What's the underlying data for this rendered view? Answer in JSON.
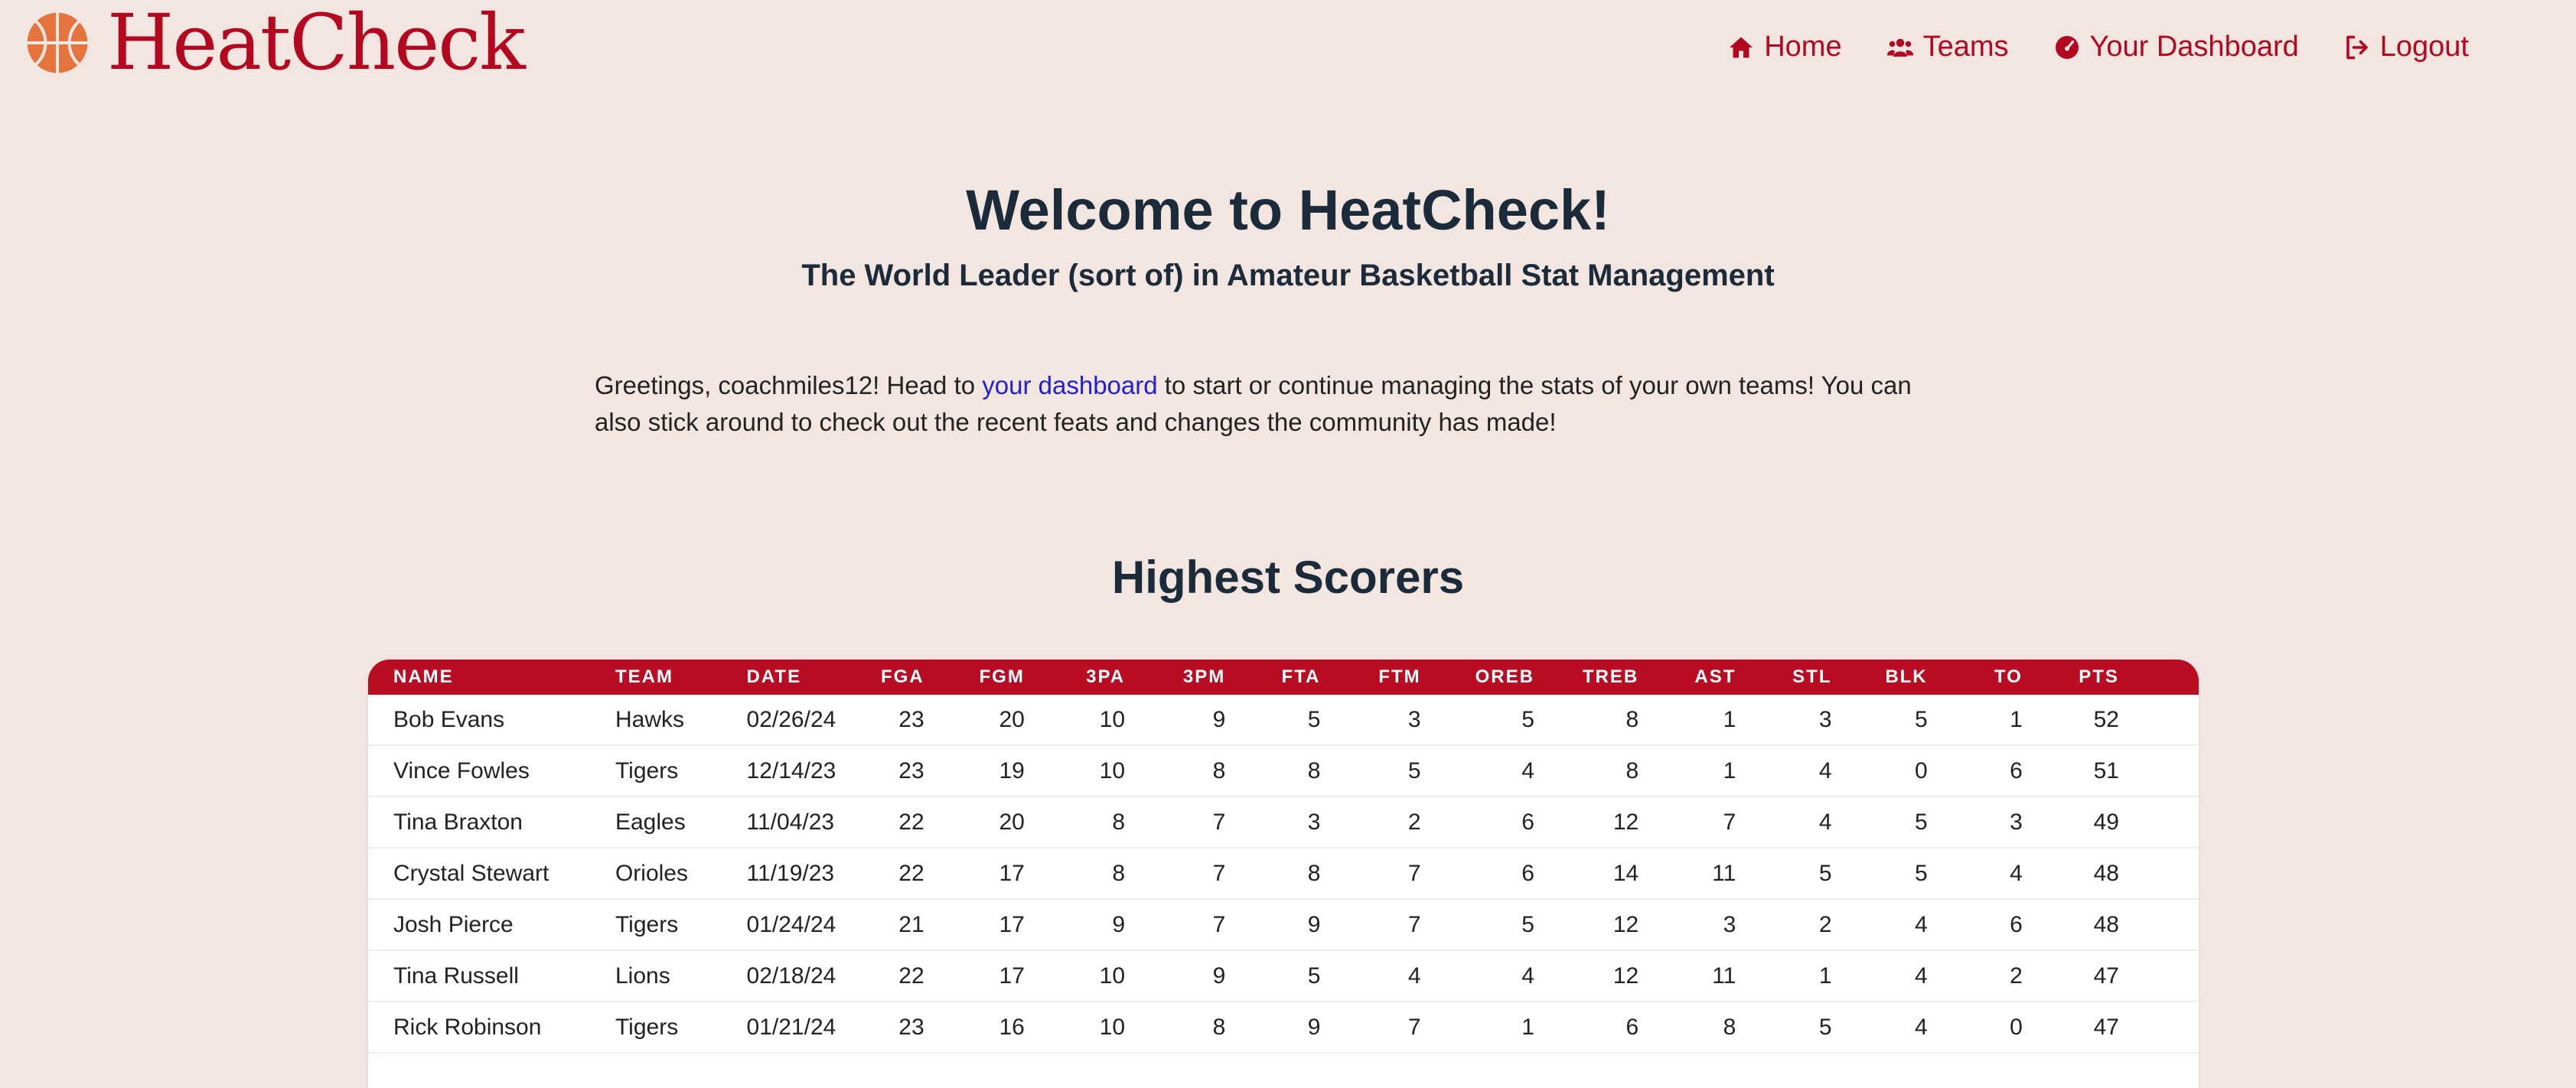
{
  "brand": {
    "name": "HeatCheck"
  },
  "nav": [
    {
      "label": "Home",
      "icon": "home-icon"
    },
    {
      "label": "Teams",
      "icon": "users-icon"
    },
    {
      "label": "Your Dashboard",
      "icon": "gauge-icon"
    },
    {
      "label": "Logout",
      "icon": "logout-icon"
    }
  ],
  "hero": {
    "title": "Welcome to HeatCheck!",
    "subtitle": "The World Leader (sort of) in Amateur Basketball Stat Management"
  },
  "intro": {
    "before_link": "Greetings, coachmiles12! Head to ",
    "link": "your dashboard",
    "after_link": " to start or continue managing the stats of your own teams! You can also stick around to check out the recent feats and changes the community has made!"
  },
  "section": {
    "title": "Highest Scorers"
  },
  "table": {
    "columns": [
      "NAME",
      "TEAM",
      "DATE",
      "FGA",
      "FGM",
      "3PA",
      "3PM",
      "FTA",
      "FTM",
      "OREB",
      "TREB",
      "AST",
      "STL",
      "BLK",
      "TO",
      "PTS"
    ],
    "rows": [
      [
        "Bob Evans",
        "Hawks",
        "02/26/24",
        "23",
        "20",
        "10",
        "9",
        "5",
        "3",
        "5",
        "8",
        "1",
        "3",
        "5",
        "1",
        "52"
      ],
      [
        "Vince Fowles",
        "Tigers",
        "12/14/23",
        "23",
        "19",
        "10",
        "8",
        "8",
        "5",
        "4",
        "8",
        "1",
        "4",
        "0",
        "6",
        "51"
      ],
      [
        "Tina Braxton",
        "Eagles",
        "11/04/23",
        "22",
        "20",
        "8",
        "7",
        "3",
        "2",
        "6",
        "12",
        "7",
        "4",
        "5",
        "3",
        "49"
      ],
      [
        "Crystal Stewart",
        "Orioles",
        "11/19/23",
        "22",
        "17",
        "8",
        "7",
        "8",
        "7",
        "6",
        "14",
        "11",
        "5",
        "5",
        "4",
        "48"
      ],
      [
        "Josh Pierce",
        "Tigers",
        "01/24/24",
        "21",
        "17",
        "9",
        "7",
        "9",
        "7",
        "5",
        "12",
        "3",
        "2",
        "4",
        "6",
        "48"
      ],
      [
        "Tina Russell",
        "Lions",
        "02/18/24",
        "22",
        "17",
        "10",
        "9",
        "5",
        "4",
        "4",
        "12",
        "11",
        "1",
        "4",
        "2",
        "47"
      ],
      [
        "Rick Robinson",
        "Tigers",
        "01/21/24",
        "23",
        "16",
        "10",
        "8",
        "9",
        "7",
        "1",
        "6",
        "8",
        "5",
        "4",
        "0",
        "47"
      ]
    ]
  },
  "colors": {
    "accent": "#b80d22",
    "background": "#f3e6e1",
    "heading": "#1b2b3a",
    "link": "#1f1fd6"
  }
}
